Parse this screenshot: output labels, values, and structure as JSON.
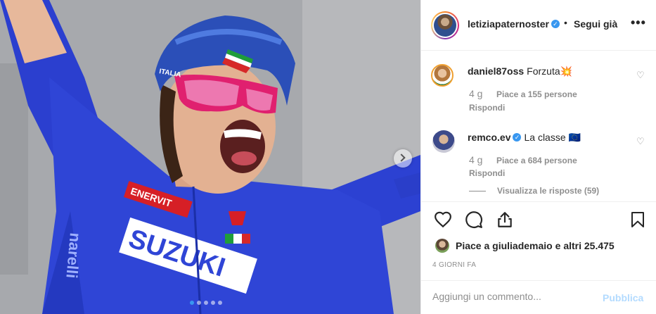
{
  "post": {
    "carousel_dots": 5,
    "active_dot": 0,
    "next_icon": "chevron-right-icon",
    "jersey_text": [
      "ENERVIT",
      "SUZUKI",
      "ITALIA"
    ]
  },
  "header": {
    "username": "letiziapaternoster",
    "verified_icon": "verified-badge-icon",
    "separator": "•",
    "follow_label": "Segui già",
    "more_icon": "more-options-icon"
  },
  "comments": [
    {
      "username": "daniel87oss",
      "text": "Forzuta💥",
      "time": "4 g",
      "likes": "Piace a 155 persone",
      "reply": "Rispondi",
      "verified": false
    },
    {
      "username": "remco.ev",
      "text": "La classe 🇪🇺",
      "time": "4 g",
      "likes": "Piace a 684 persone",
      "reply": "Rispondi",
      "verified": true,
      "view_replies": "Visualizza le risposte (59)"
    }
  ],
  "actions": {
    "like_icon": "heart-icon",
    "comment_icon": "comment-icon",
    "share_icon": "share-icon",
    "save_icon": "bookmark-icon"
  },
  "likes": {
    "prefix": "Piace a",
    "user": "giuliademaio",
    "middle": "e",
    "others": "altri 25.475"
  },
  "time_ago": "4 GIORNI FA",
  "add_comment": {
    "placeholder": "Aggiungi un commento...",
    "publish_label": "Pubblica"
  },
  "colors": {
    "accent": "#3897f0",
    "publish_disabled": "#b3dbff",
    "jersey": "#2f45d6"
  }
}
